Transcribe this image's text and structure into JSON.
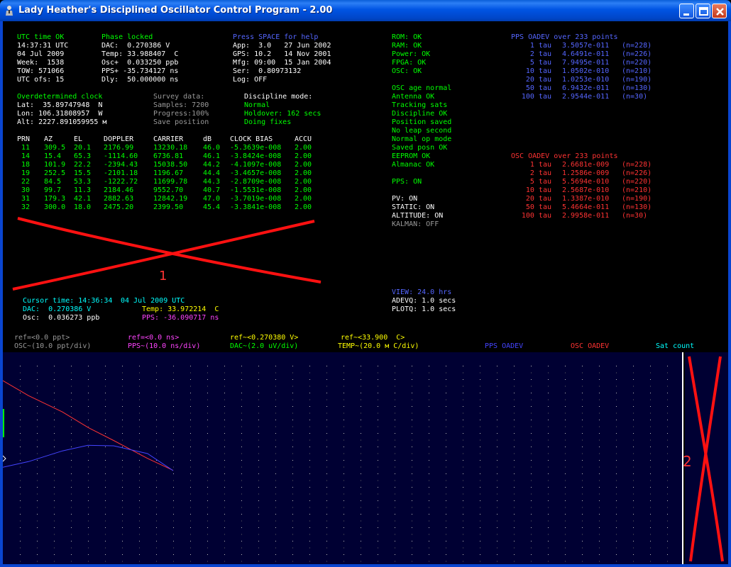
{
  "window": {
    "title": "Lady Heather's Disciplined Oscillator Control Program - 2.00"
  },
  "status_left": {
    "header": "UTC time OK",
    "time": "14:37:31 UTC",
    "date": "04 Jul 2009",
    "week": "Week:  1538",
    "tow": "TOW: 571066",
    "utc_ofs": "UTC ofs: 15"
  },
  "status_phase": {
    "header": "Phase locked",
    "dac": "DAC:  0.270386 V",
    "temp": "Temp: 33.988407  C",
    "osc": "Osc+  0.033250 ppb",
    "pps": "PPS+ -35.734127 ns",
    "dly": "Dly:  50.000000 ns"
  },
  "status_help": {
    "header": "Press SPACE for help",
    "app": "App:  3.0   27 Jun 2002",
    "gps": "GPS: 10.2   14 Nov 2001",
    "mfg": "Mfg: 09:00  15 Jan 2004",
    "ser": "Ser:  0.80973132",
    "log": "Log: OFF"
  },
  "position": {
    "header": "Overdetermined clock",
    "lat": "Lat:  35.89747948  N",
    "lon": "Lon: 106.31808957  W",
    "alt": "Alt: 2227.891059955 м"
  },
  "survey": {
    "header": "Survey data:",
    "samples": "Samples: 7200",
    "progress": "Progress:100%",
    "save": "Save position"
  },
  "discipline": {
    "header": "Discipline mode:",
    "mode": "Normal",
    "holdover": "Holdover: 162 secs",
    "fixes": "Doing fixes"
  },
  "sat_table": {
    "headers": [
      "PRN",
      "AZ",
      "EL",
      "DOPPLER",
      "CARRIER",
      "dB",
      "CLOCK BIAS",
      "ACCU"
    ],
    "rows": [
      [
        "11",
        "309.5",
        "20.1",
        "2176.99",
        "13230.18",
        "46.0",
        "-5.3639e-008",
        "2.00"
      ],
      [
        "14",
        "15.4",
        "65.3",
        "-1114.60",
        "6736.81",
        "46.1",
        "-3.8424e-008",
        "2.00"
      ],
      [
        "18",
        "101.9",
        "22.2",
        "-2394.43",
        "15038.50",
        "44.2",
        "-4.1097e-008",
        "2.00"
      ],
      [
        "19",
        "252.5",
        "15.5",
        "-2101.18",
        "1196.67",
        "44.4",
        "-3.4657e-008",
        "2.00"
      ],
      [
        "22",
        "84.5",
        "53.3",
        "-1222.72",
        "11699.78",
        "44.3",
        "-2.8709e-008",
        "2.00"
      ],
      [
        "30",
        "99.7",
        "11.3",
        "2184.46",
        "9552.70",
        "40.7",
        "-1.5531e-008",
        "2.00"
      ],
      [
        "31",
        "179.3",
        "42.1",
        "2882.63",
        "12842.19",
        "47.0",
        "-3.7019e-008",
        "2.00"
      ],
      [
        "32",
        "300.0",
        "18.0",
        "2475.20",
        "2399.50",
        "45.4",
        "-3.3841e-008",
        "2.00"
      ]
    ]
  },
  "annotations": {
    "mark1": "1",
    "mark2": "2"
  },
  "cursor": {
    "time_label": "Cursor time: 14:36:34",
    "date": "04 Jul 2009 UTC",
    "dac": "DAC:  0.270386 V",
    "osc": "Osc:  0.036273 ppb",
    "temp": "Temp: 33.972214  C",
    "pps": "PPS: -36.090717 ns"
  },
  "health": {
    "items_green": [
      "ROM: OK",
      "RAM: OK",
      "Power: OK",
      "FPGA: OK",
      "OSC: OK"
    ],
    "items_green2": [
      "OSC age normal",
      "Antenna OK",
      "Tracking sats",
      "Discipline OK",
      "Position saved",
      "No leap second",
      "Normal op mode",
      "Saved posn OK",
      "EEPROM OK",
      "Almanac OK"
    ],
    "pps_status": "PPS: ON",
    "pv": "PV: ON",
    "static": "STATIC: ON",
    "altitude": "ALTITUDE: ON",
    "kalman": "KALMAN: OFF",
    "view": "VIEW: 24.0 hrs",
    "adev_q": "ADEVQ: 1.0 secs",
    "plot_q": "PLOTQ: 1.0 secs"
  },
  "pps_adev": {
    "title": "PPS OADEV over 233 points",
    "rows": [
      [
        "1 tau",
        "3.5057e-011",
        "(n=228)"
      ],
      [
        "2 tau",
        "4.6491e-011",
        "(n=226)"
      ],
      [
        "5 tau",
        "7.9495e-011",
        "(n=220)"
      ],
      [
        "10 tau",
        "1.0502e-010",
        "(n=210)"
      ],
      [
        "20 tau",
        "1.0253e-010",
        "(n=190)"
      ],
      [
        "50 tau",
        "6.9432e-011",
        "(n=130)"
      ],
      [
        "100 tau",
        "2.9544e-011",
        "(n=30)"
      ]
    ]
  },
  "osc_adev": {
    "title": "OSC OADEV over 233 points",
    "rows": [
      [
        "1 tau",
        "2.6681e-009",
        "(n=228)"
      ],
      [
        "2 tau",
        "1.2586e-009",
        "(n=226)"
      ],
      [
        "5 tau",
        "5.5694e-010",
        "(n=220)"
      ],
      [
        "10 tau",
        "2.5687e-010",
        "(n=210)"
      ],
      [
        "20 tau",
        "1.3387e-010",
        "(n=190)"
      ],
      [
        "50 tau",
        "5.4664e-011",
        "(n=130)"
      ],
      [
        "100 tau",
        "2.9958e-011",
        "(n=30)"
      ]
    ]
  },
  "legend": {
    "ref_osc": "ref=<0.0 ppt>",
    "osc": "OSC~(10.0 ppt/div)",
    "ref_pps": "ref=<0.0 ns>",
    "pps": "PPS~(10.0 ns/div)",
    "ref_dac": "ref~<0.270380 V>",
    "dac": "DAC~(2.0 uV/div)",
    "ref_temp": "ref~<33.900  C>",
    "temp": "TEMP~(20.0 м C/div)",
    "pps_adev": "PPS OADEV",
    "osc_adev": "OSC OADEV",
    "sat_count": "Sat count"
  },
  "colors": {
    "green": "#00ff00",
    "blue": "#5566ff",
    "red": "#ff3333",
    "cyan": "#00ffff",
    "yellow": "#ffff00",
    "magenta": "#ff44ff",
    "plot_bg": "#000033"
  },
  "plot": {
    "pps_adev_points": [
      [
        1,
        3.5057e-11
      ],
      [
        2,
        4.6491e-11
      ],
      [
        5,
        7.9495e-11
      ],
      [
        10,
        1.0502e-10
      ],
      [
        20,
        1.0253e-10
      ],
      [
        50,
        6.9432e-11
      ],
      [
        100,
        2.9544e-11
      ]
    ],
    "osc_adev_points": [
      [
        1,
        2.6681e-09
      ],
      [
        2,
        1.2586e-09
      ],
      [
        5,
        5.5694e-10
      ],
      [
        10,
        2.5687e-10
      ],
      [
        20,
        1.3387e-10
      ],
      [
        50,
        5.4664e-11
      ],
      [
        100,
        2.9958e-11
      ]
    ]
  }
}
